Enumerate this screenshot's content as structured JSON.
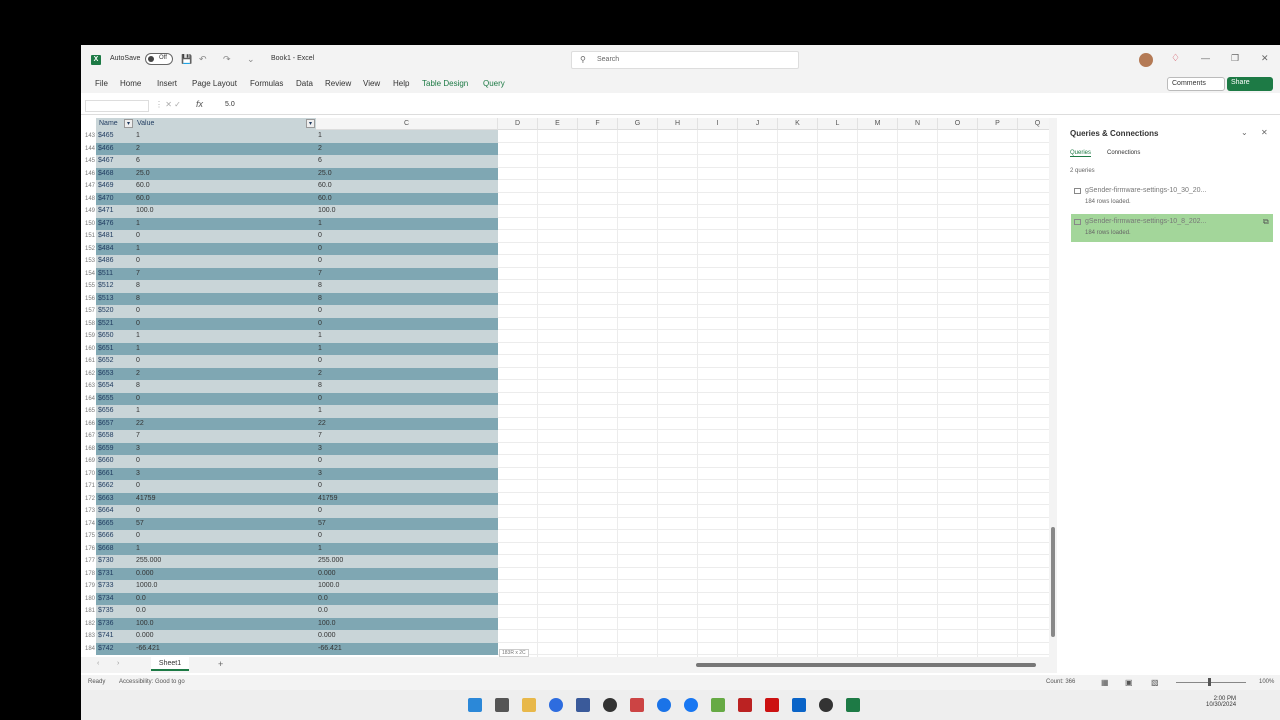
{
  "titlebar": {
    "app_letter": "X",
    "autosave_label": "AutoSave",
    "toggle_state": "Off",
    "document_title": "Book1 - Excel",
    "search_placeholder": "Search"
  },
  "menu": [
    "File",
    "Home",
    "Insert",
    "Page Layout",
    "Formulas",
    "Data",
    "Review",
    "View",
    "Help",
    "Table Design",
    "Query"
  ],
  "menu_buttons": {
    "comments": "Comments",
    "share": "Share"
  },
  "formula_bar": {
    "fx_label": "fx",
    "value": "5.0"
  },
  "column_headers": {
    "name": "Name",
    "value": "Value",
    "c": "C",
    "others": [
      "D",
      "E",
      "F",
      "G",
      "H",
      "I",
      "J",
      "K",
      "L",
      "M",
      "N",
      "O",
      "P",
      "Q"
    ]
  },
  "rows": [
    {
      "num": "143",
      "name": "$465",
      "value": "1",
      "c": "1"
    },
    {
      "num": "144",
      "name": "$466",
      "value": "2",
      "c": "2"
    },
    {
      "num": "145",
      "name": "$467",
      "value": "6",
      "c": "6"
    },
    {
      "num": "146",
      "name": "$468",
      "value": "25.0",
      "c": "25.0"
    },
    {
      "num": "147",
      "name": "$469",
      "value": "60.0",
      "c": "60.0"
    },
    {
      "num": "148",
      "name": "$470",
      "value": "60.0",
      "c": "60.0"
    },
    {
      "num": "149",
      "name": "$471",
      "value": "100.0",
      "c": "100.0"
    },
    {
      "num": "150",
      "name": "$476",
      "value": "1",
      "c": "1"
    },
    {
      "num": "151",
      "name": "$481",
      "value": "0",
      "c": "0"
    },
    {
      "num": "152",
      "name": "$484",
      "value": "1",
      "c": "0"
    },
    {
      "num": "153",
      "name": "$486",
      "value": "0",
      "c": "0"
    },
    {
      "num": "154",
      "name": "$511",
      "value": "7",
      "c": "7"
    },
    {
      "num": "155",
      "name": "$512",
      "value": "8",
      "c": "8"
    },
    {
      "num": "156",
      "name": "$513",
      "value": "8",
      "c": "8"
    },
    {
      "num": "157",
      "name": "$520",
      "value": "0",
      "c": "0"
    },
    {
      "num": "158",
      "name": "$521",
      "value": "0",
      "c": "0"
    },
    {
      "num": "159",
      "name": "$650",
      "value": "1",
      "c": "1"
    },
    {
      "num": "160",
      "name": "$651",
      "value": "1",
      "c": "1"
    },
    {
      "num": "161",
      "name": "$652",
      "value": "0",
      "c": "0"
    },
    {
      "num": "162",
      "name": "$653",
      "value": "2",
      "c": "2"
    },
    {
      "num": "163",
      "name": "$654",
      "value": "8",
      "c": "8"
    },
    {
      "num": "164",
      "name": "$655",
      "value": "0",
      "c": "0"
    },
    {
      "num": "165",
      "name": "$656",
      "value": "1",
      "c": "1"
    },
    {
      "num": "166",
      "name": "$657",
      "value": "22",
      "c": "22"
    },
    {
      "num": "167",
      "name": "$658",
      "value": "7",
      "c": "7"
    },
    {
      "num": "168",
      "name": "$659",
      "value": "3",
      "c": "3"
    },
    {
      "num": "169",
      "name": "$660",
      "value": "0",
      "c": "0"
    },
    {
      "num": "170",
      "name": "$661",
      "value": "3",
      "c": "3"
    },
    {
      "num": "171",
      "name": "$662",
      "value": "0",
      "c": "0"
    },
    {
      "num": "172",
      "name": "$663",
      "value": "41759",
      "c": "41759"
    },
    {
      "num": "173",
      "name": "$664",
      "value": "0",
      "c": "0"
    },
    {
      "num": "174",
      "name": "$665",
      "value": "57",
      "c": "57"
    },
    {
      "num": "175",
      "name": "$666",
      "value": "0",
      "c": "0"
    },
    {
      "num": "176",
      "name": "$668",
      "value": "1",
      "c": "1"
    },
    {
      "num": "177",
      "name": "$730",
      "value": "255.000",
      "c": "255.000"
    },
    {
      "num": "178",
      "name": "$731",
      "value": "0.000",
      "c": "0.000"
    },
    {
      "num": "179",
      "name": "$733",
      "value": "1000.0",
      "c": "1000.0"
    },
    {
      "num": "180",
      "name": "$734",
      "value": "0.0",
      "c": "0.0"
    },
    {
      "num": "181",
      "name": "$735",
      "value": "0.0",
      "c": "0.0"
    },
    {
      "num": "182",
      "name": "$736",
      "value": "100.0",
      "c": "100.0"
    },
    {
      "num": "183",
      "name": "$741",
      "value": "0.000",
      "c": "0.000"
    },
    {
      "num": "184",
      "name": "$742",
      "value": "-66.421",
      "c": "-66.421"
    }
  ],
  "selection_tag": "183R x 2C",
  "sheet_tab": "Sheet1",
  "status": {
    "ready": "Ready",
    "accessibility": "Accessibility: Good to go",
    "count": "Count: 366",
    "zoom": "100%"
  },
  "queries_pane": {
    "title": "Queries & Connections",
    "tabs": [
      "Queries",
      "Connections"
    ],
    "count_label": "2 queries",
    "items": [
      {
        "name": "gSender-firmware-settings-10_30_20...",
        "status": "184 rows loaded."
      },
      {
        "name": "gSender-firmware-settings-10_8_202...",
        "status": "184 rows loaded."
      }
    ]
  },
  "taskbar": {
    "time": "2:00 PM",
    "date": "10/30/2024"
  },
  "colors": {
    "excel_green": "#1d7a45",
    "table_dark": "#7fa7b3",
    "table_light": "#c9d5d8",
    "row_select": "#a3d69a"
  }
}
